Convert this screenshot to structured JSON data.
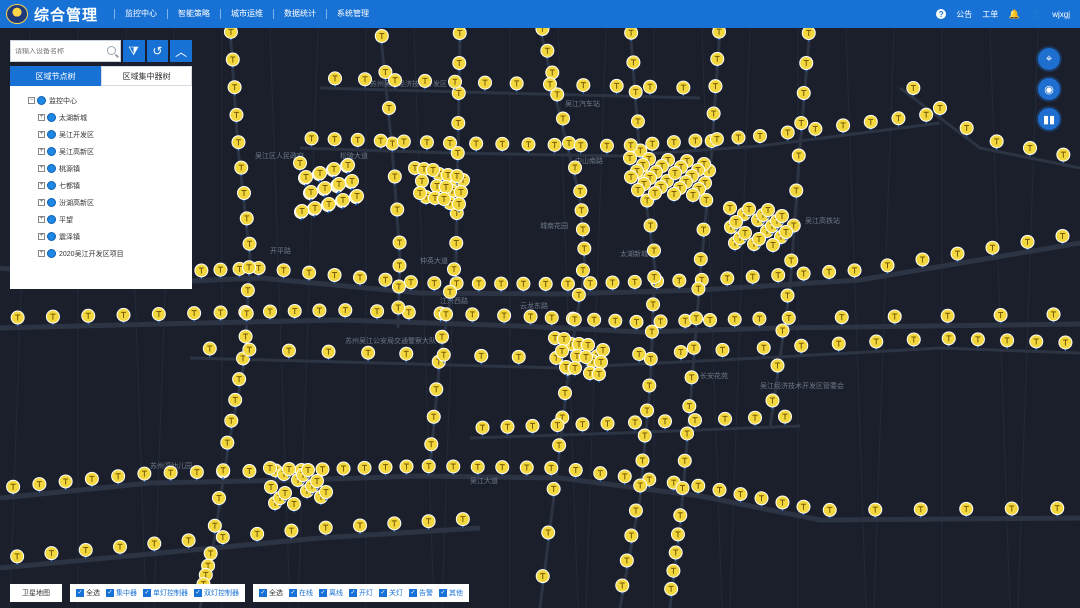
{
  "header": {
    "app_title": "综合管理",
    "nav": [
      "监控中心",
      "智能策略",
      "城市运维",
      "数据统计",
      "系统管理"
    ],
    "notice_label": "公告",
    "workorder_label": "工单",
    "user_name": "wjxgj"
  },
  "panel": {
    "search_placeholder": "请输入设备名称",
    "tabs": [
      "区域节点树",
      "区域集中器树"
    ],
    "tree_root": "监控中心",
    "tree_items": [
      "太湖新城",
      "吴江开发区",
      "吴江高新区",
      "桃源镇",
      "七都镇",
      "汾湖高新区",
      "平望",
      "震泽镇",
      "2020吴江开发区项目"
    ]
  },
  "bottom": {
    "satellite_label": "卫星地图",
    "group1": [
      "全选",
      "集中器",
      "单灯控制器",
      "双灯控制器"
    ],
    "group2": [
      "全选",
      "在线",
      "离线",
      "开灯",
      "关灯",
      "告警",
      "其他"
    ]
  },
  "map_labels": [
    "苏州吴江经济技术开发区",
    "吴江汽车站",
    "吴江区人民政府",
    "吴江高铁站",
    "太湖新城",
    "松陵大道",
    "开平路",
    "江兴西路",
    "云龙东路",
    "吴江大道",
    "中山南路",
    "苏州湾幼儿园",
    "长安花苑",
    "城南花园",
    "仲英大道",
    "吴江经济技术开发区管委会",
    "苏州吴江公安局交通警察大队"
  ],
  "colors": {
    "topbar": "#1872d6",
    "map_bg": "#1a1f2b",
    "road": "#2c3444",
    "marker": "#f2d73e"
  }
}
